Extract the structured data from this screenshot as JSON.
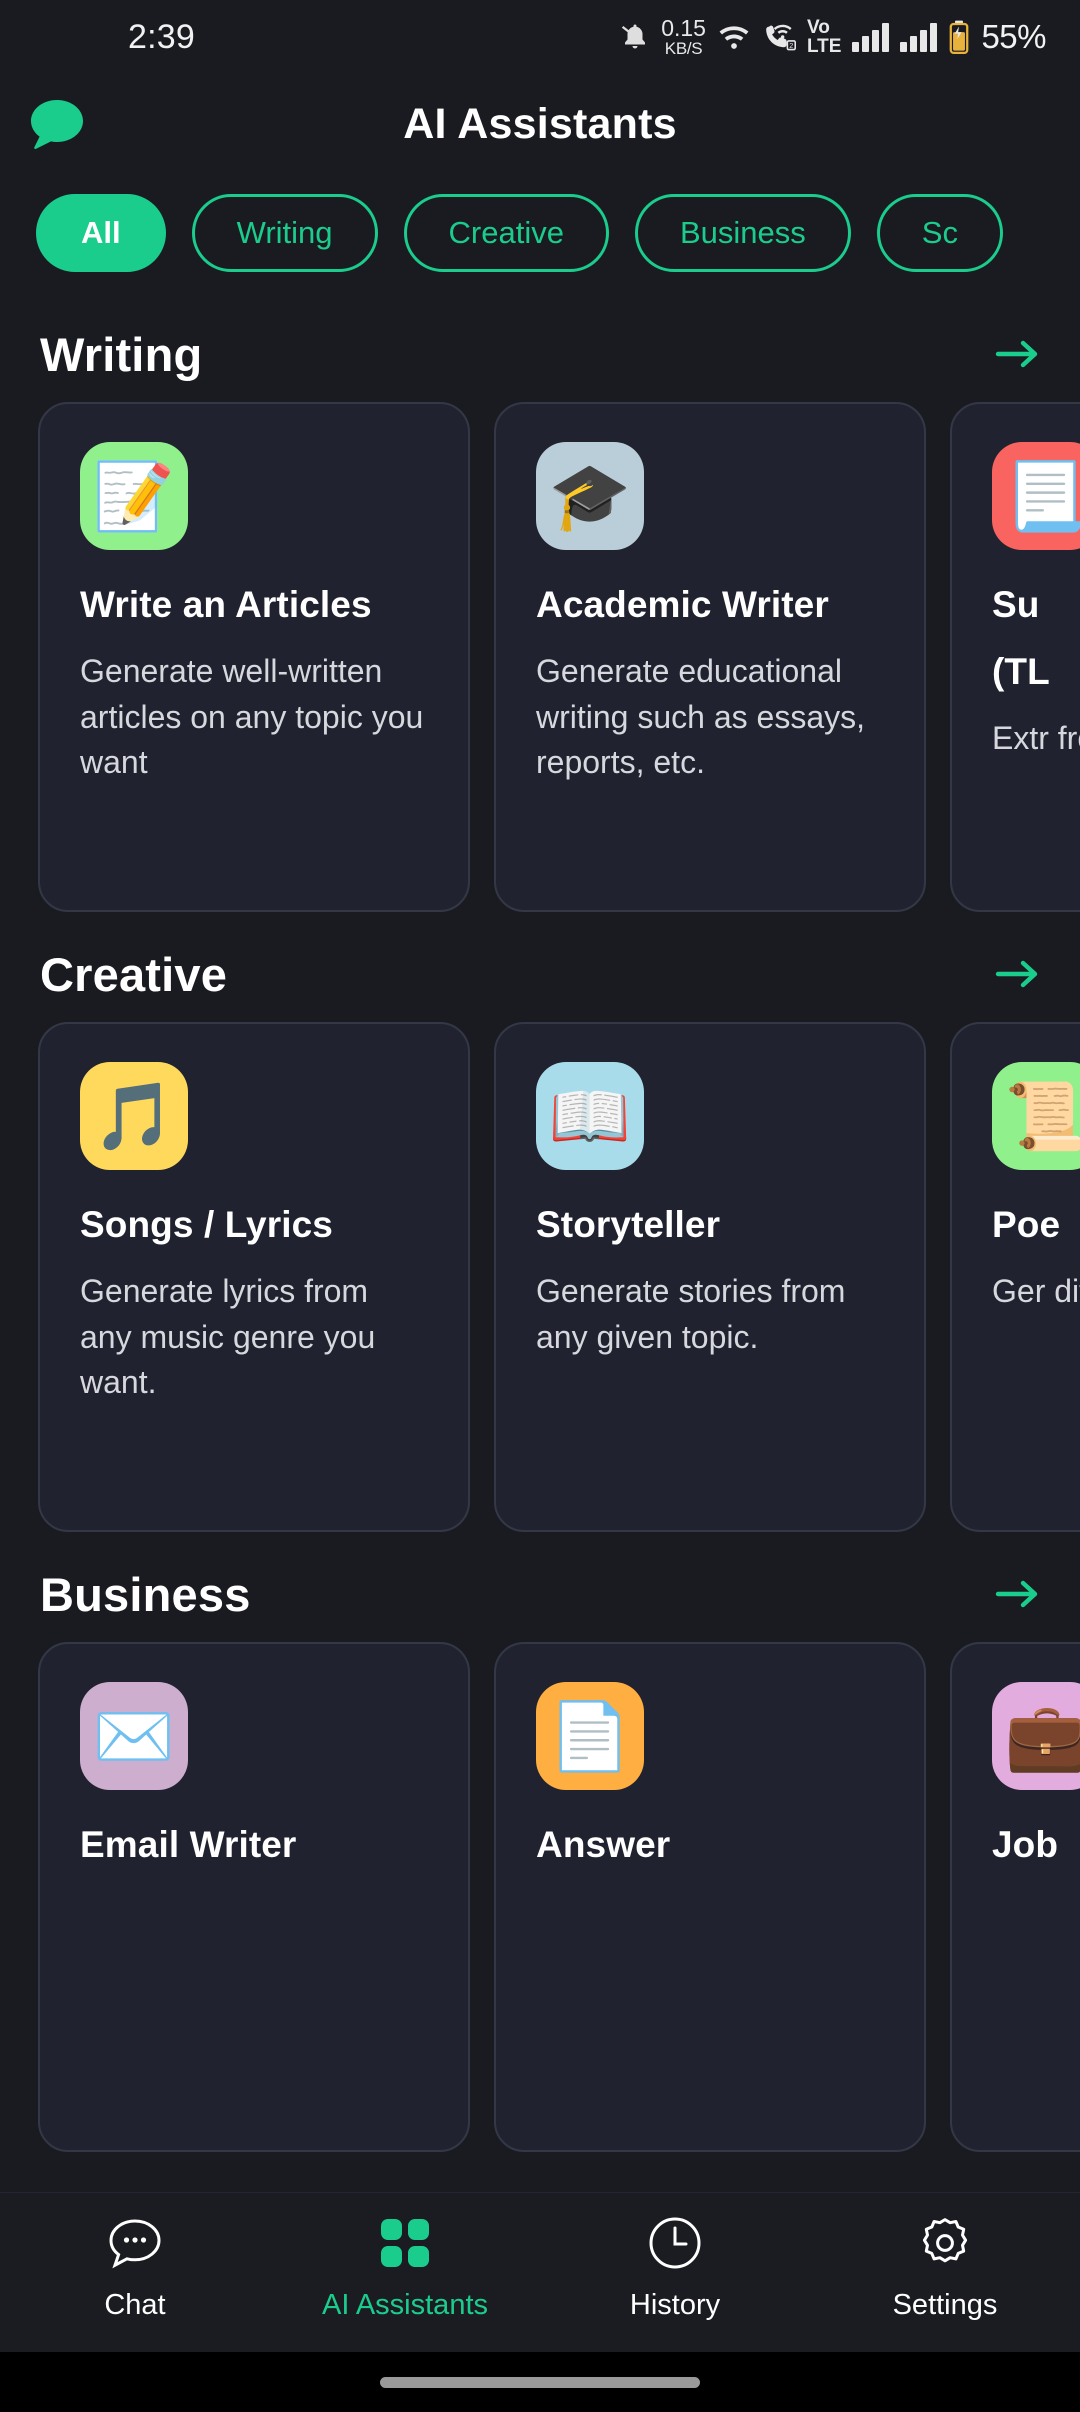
{
  "theme": {
    "accent": "#1bcd8c",
    "page_bg": "#1a1b21",
    "card_bg": "#20232f",
    "card_border": "#343846",
    "text_primary": "#ffffff",
    "text_secondary": "#d6d8dd"
  },
  "status_bar": {
    "time": "2:39",
    "network_speed_value": "0.15",
    "network_speed_unit": "KB/S",
    "volte_line1": "Vo",
    "volte_line2": "LTE",
    "sim_badge": "2",
    "battery": "55%",
    "icons": [
      "notification-muted-icon",
      "wifi-icon",
      "call-wifi-icon",
      "volte-icon",
      "signal-sim1-icon",
      "signal-sim2-icon",
      "battery-charging-icon"
    ]
  },
  "header": {
    "title": "AI Assistants",
    "logo": "chat-bubble-logo"
  },
  "filters": {
    "chips": [
      {
        "label": "All",
        "active": true
      },
      {
        "label": "Writing",
        "active": false
      },
      {
        "label": "Creative",
        "active": false
      },
      {
        "label": "Business",
        "active": false
      },
      {
        "label": "Sc",
        "active": false
      }
    ]
  },
  "sections": [
    {
      "title": "Writing",
      "arrow": "arrow-right-icon",
      "cards": [
        {
          "title": "Write an Articles",
          "desc": "Generate well-written articles on any topic you want",
          "emoji": "📝",
          "icon_name": "memo-emoji",
          "icon_bg": "#90f08c"
        },
        {
          "title": "Academic Writer",
          "desc": "Generate educational writing such as essays, reports, etc.",
          "emoji": "🎓",
          "icon_name": "graduation-cap-emoji",
          "icon_bg": "#b9ced8"
        },
        {
          "title": "Su",
          "desc": "Extr from",
          "title_line2": "(TL",
          "emoji": "📃",
          "icon_name": "page-with-curl-emoji",
          "icon_bg": "#fa6460"
        }
      ]
    },
    {
      "title": "Creative",
      "arrow": "arrow-right-icon",
      "cards": [
        {
          "title": "Songs / Lyrics",
          "desc": "Generate lyrics from any music genre you want.",
          "emoji": "🎵",
          "icon_name": "musical-note-emoji",
          "icon_bg": "#ffd95c"
        },
        {
          "title": "Storyteller",
          "desc": "Generate stories from any given topic.",
          "emoji": "📖",
          "icon_name": "open-book-emoji",
          "icon_bg": "#a8dceb"
        },
        {
          "title": "Poe",
          "desc": "Ger diff",
          "emoji": "📜",
          "icon_name": "scroll-emoji",
          "icon_bg": "#90f08c"
        }
      ]
    },
    {
      "title": "Business",
      "arrow": "arrow-right-icon",
      "cards": [
        {
          "title": "Email Writer",
          "desc": "",
          "emoji": "✉️",
          "icon_name": "envelope-emoji",
          "icon_bg": "#cdaecf"
        },
        {
          "title": "Answer",
          "desc": "",
          "emoji": "📄",
          "icon_name": "document-emoji",
          "icon_bg": "#ffae41"
        },
        {
          "title": "Job",
          "desc": "",
          "emoji": "💼",
          "icon_name": "briefcase-emoji",
          "icon_bg": "#e3acde"
        }
      ]
    }
  ],
  "bottom_nav": [
    {
      "label": "Chat",
      "icon": "chat-bubble-dots-icon",
      "active": false
    },
    {
      "label": "AI Assistants",
      "icon": "grid-squares-icon",
      "active": true
    },
    {
      "label": "History",
      "icon": "clock-icon",
      "active": false
    },
    {
      "label": "Settings",
      "icon": "gear-icon",
      "active": false
    }
  ]
}
